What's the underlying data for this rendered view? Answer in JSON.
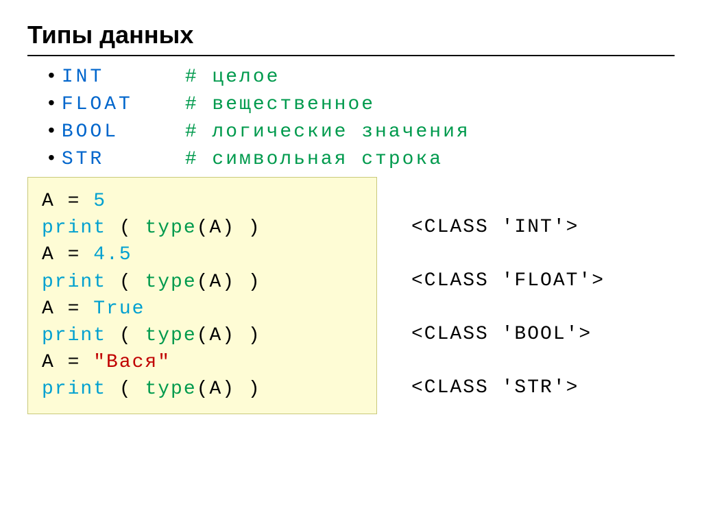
{
  "title": "Типы данных",
  "types": [
    {
      "kw": "int",
      "comment": "# целое"
    },
    {
      "kw": "float",
      "comment": "# вещественное"
    },
    {
      "kw": "bool",
      "comment": "# логические значения"
    },
    {
      "kw": "str",
      "comment": "# символьная строка"
    }
  ],
  "code": {
    "l1a": "A = ",
    "l1b": "5",
    "l2a": "print",
    "l2b": " ( ",
    "l2c": "type",
    "l2d": "(A) )",
    "l3a": "A = ",
    "l3b": "4.5",
    "l4a": "print",
    "l4b": " ( ",
    "l4c": "type",
    "l4d": "(A) )",
    "l5a": "A = ",
    "l5b": "True",
    "l6a": "print",
    "l6b": " ( ",
    "l6c": "type",
    "l6d": "(A) )",
    "l7a": "A = ",
    "l7b": "\"Вася\"",
    "l8a": "print",
    "l8b": " ( ",
    "l8c": "type",
    "l8d": "(A) )"
  },
  "output": {
    "o1": "<class 'int'>",
    "o2": "<class 'float'>",
    "o3": "<class 'bool'>",
    "o4": "<class 'str'>"
  }
}
